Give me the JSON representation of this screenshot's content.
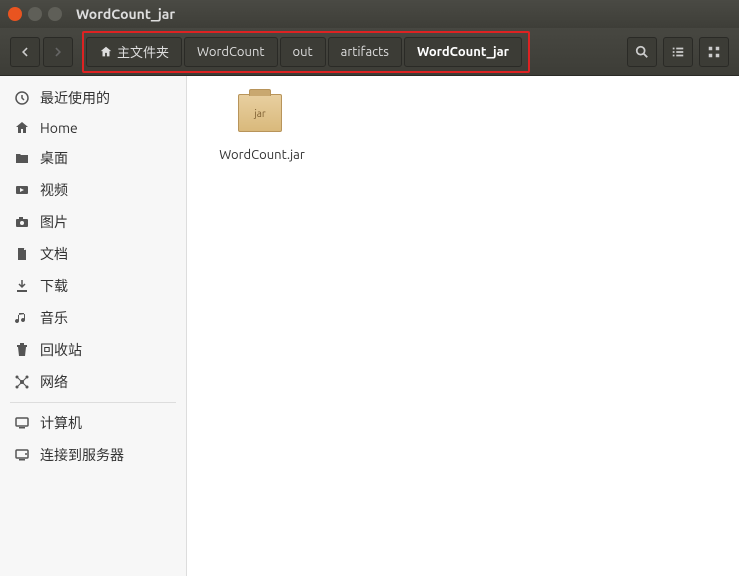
{
  "window": {
    "title": "WordCount_jar"
  },
  "breadcrumb": {
    "home": "主文件夹",
    "segs": [
      "WordCount",
      "out",
      "artifacts",
      "WordCount_jar"
    ],
    "active_index": 3
  },
  "sidebar": {
    "groups": [
      [
        {
          "key": "recent",
          "label": "最近使用的",
          "icon": "clock"
        },
        {
          "key": "home",
          "label": "Home",
          "icon": "home"
        },
        {
          "key": "desktop",
          "label": "桌面",
          "icon": "folder"
        },
        {
          "key": "videos",
          "label": "视频",
          "icon": "video"
        },
        {
          "key": "pictures",
          "label": "图片",
          "icon": "camera"
        },
        {
          "key": "documents",
          "label": "文档",
          "icon": "doc"
        },
        {
          "key": "downloads",
          "label": "下载",
          "icon": "download"
        },
        {
          "key": "music",
          "label": "音乐",
          "icon": "music"
        },
        {
          "key": "trash",
          "label": "回收站",
          "icon": "trash"
        },
        {
          "key": "network",
          "label": "网络",
          "icon": "network"
        }
      ],
      [
        {
          "key": "computer",
          "label": "计算机",
          "icon": "computer"
        },
        {
          "key": "server",
          "label": "连接到服务器",
          "icon": "server"
        }
      ]
    ]
  },
  "files": [
    {
      "name": "WordCount.jar",
      "type": "jar"
    }
  ]
}
